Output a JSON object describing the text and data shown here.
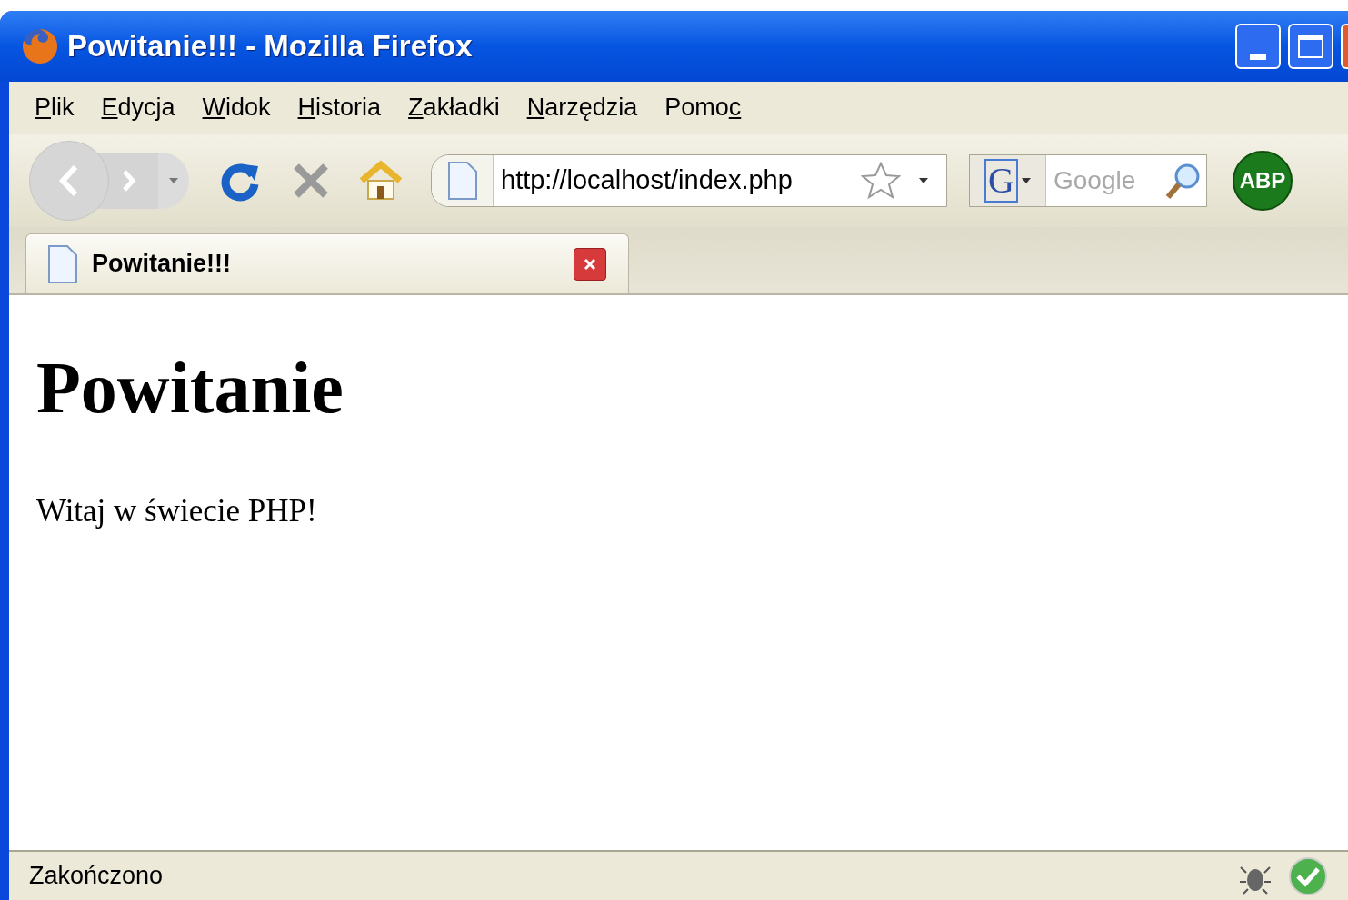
{
  "window": {
    "title": "Powitanie!!! - Mozilla Firefox"
  },
  "menu": [
    {
      "key": "P",
      "after": "lik"
    },
    {
      "key": "E",
      "after": "dycja"
    },
    {
      "key": "W",
      "after": "idok"
    },
    {
      "key": "H",
      "after": "istoria"
    },
    {
      "key": "Z",
      "after": "akładki"
    },
    {
      "key": "N",
      "after": "arzędzia"
    },
    {
      "before": "Pomo",
      "key": "c"
    }
  ],
  "toolbar": {
    "address": "http://localhost/index.php",
    "search_placeholder": "Google",
    "search_engine": "G",
    "addon_badge": "ABP"
  },
  "tabs": [
    {
      "label": "Powitanie!!!",
      "selected": true
    }
  ],
  "page": {
    "heading": "Powitanie",
    "paragraph": "Witaj w świecie PHP!"
  },
  "status_bar": {
    "text": "Zakończono"
  }
}
